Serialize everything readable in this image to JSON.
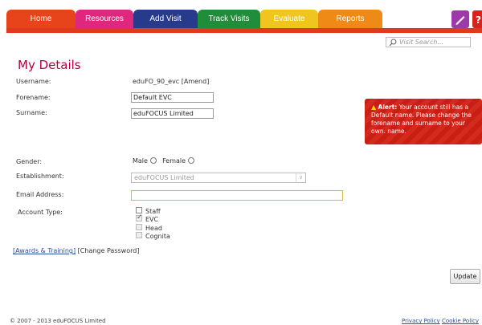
{
  "nav": {
    "tabs": [
      {
        "label": "Home",
        "color": "#e8441b"
      },
      {
        "label": "Resources",
        "color": "#e0277e"
      },
      {
        "label": "Add Visit",
        "color": "#283a8c"
      },
      {
        "label": "Track Visits",
        "color": "#1f8d3a"
      },
      {
        "label": "Evaluate",
        "color": "#f0c51f"
      },
      {
        "label": "Reports",
        "color": "#f08a17"
      }
    ],
    "tools": [
      {
        "icon": "pencil-icon",
        "color": "#9b3aa8"
      },
      {
        "icon": "help-icon",
        "color": "#d8231b"
      }
    ]
  },
  "search": {
    "placeholder": "Visit Search..."
  },
  "page": {
    "title": "My Details"
  },
  "form": {
    "username_label": "Username:",
    "username_value": "eduFO_90_evc",
    "amend_link": "[Amend]",
    "forename_label": "Forename:",
    "forename_value": "Default EVC",
    "surname_label": "Surname:",
    "surname_value": "eduFOCUS Limited",
    "gender_label": "Gender:",
    "gender_male": "Male",
    "gender_female": "Female",
    "establishment_label": "Establishment:",
    "establishment_value": "eduFOCUS Limited",
    "email_label": "Email Address:",
    "email_value": "",
    "account_type_label": "Account Type:",
    "account_types": [
      {
        "label": "Staff",
        "checked": false,
        "disabled": false
      },
      {
        "label": "EVC",
        "checked": true,
        "disabled": true
      },
      {
        "label": "Head",
        "checked": false,
        "disabled": true
      },
      {
        "label": "Cognita",
        "checked": false,
        "disabled": true
      }
    ]
  },
  "alert": {
    "title": "Alert:",
    "message": "Your account still has a Default name. Please change the forename and surname to your own. name."
  },
  "links": {
    "awards": "[Awards & Training]",
    "change_password": "[Change Password]"
  },
  "actions": {
    "update": "Update"
  },
  "footer": {
    "copyright": "© 2007 - 2013 eduFOCUS Limited",
    "privacy": "Privacy Policy",
    "cookie": "Cookie Policy"
  }
}
